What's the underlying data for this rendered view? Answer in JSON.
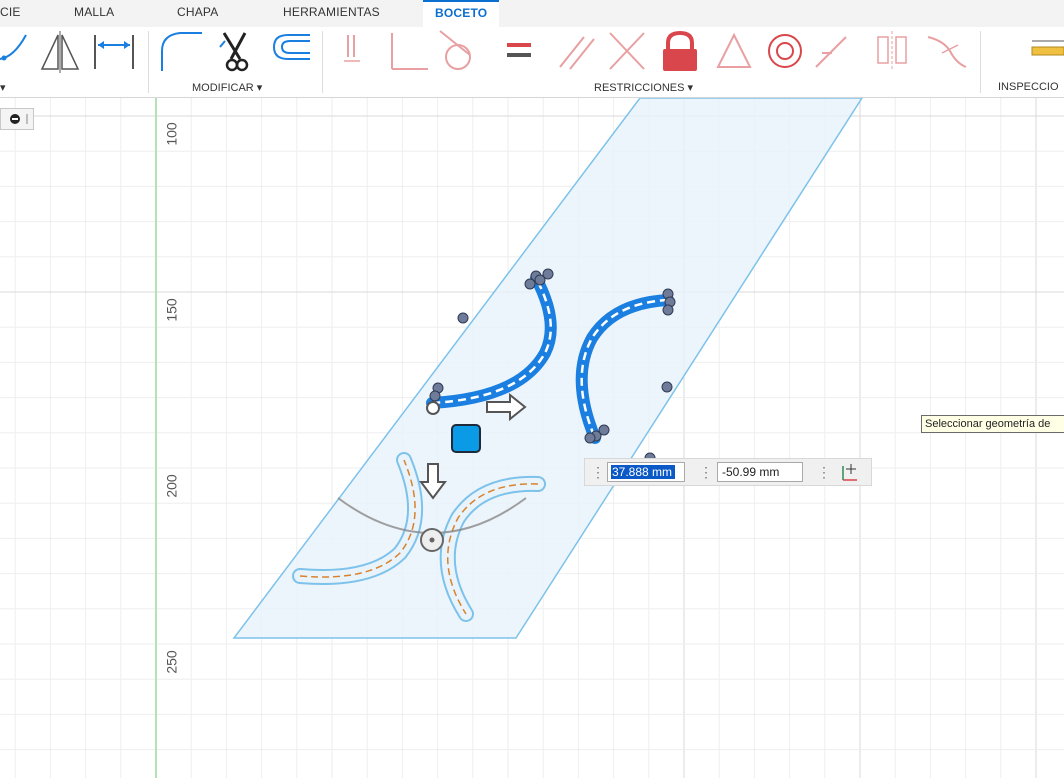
{
  "tabs": [
    "CIE",
    "MALLA",
    "CHAPA",
    "HERRAMIENTAS",
    "BOCETO"
  ],
  "active_tab": "BOCETO",
  "toolbar": {
    "groups": {
      "modificar": "MODIFICAR ▾",
      "restricciones": "RESTRICCIONES ▾",
      "inspeccion": "INSPECCIO"
    },
    "colors": {
      "accent": "#0a6fd1",
      "constraint_red": "#d9464b",
      "sketch_blue": "#1a7fe0"
    }
  },
  "canvas": {
    "y_axis_labels": [
      "100",
      "150",
      "200",
      "250"
    ],
    "tooltip": "Seleccionar geometría de"
  },
  "dimension_input": {
    "x_value": "37.888 mm",
    "y_value": "-50.99 mm"
  },
  "icons": [
    "spline-icon",
    "mirror-icon",
    "dimension-icon",
    "fillet-icon",
    "trim-icon",
    "offset-icon",
    "coincident-icon",
    "perpendicular-icon",
    "tangent-icon",
    "equal-icon",
    "parallel-icon",
    "collinear-icon",
    "fix-lock-icon",
    "triangle-icon",
    "concentric-icon",
    "midpoint-icon",
    "symmetry-icon",
    "smooth-icon",
    "measure-icon"
  ]
}
